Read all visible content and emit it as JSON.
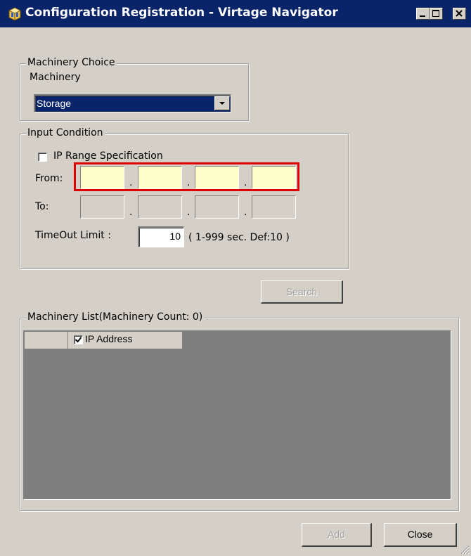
{
  "window": {
    "title": "Configuration Registration - Virtage Navigator"
  },
  "machinery_choice": {
    "group_label": "Machinery Choice",
    "field_label": "Machinery",
    "selected_value": "Storage"
  },
  "input_condition": {
    "group_label": "Input Condition",
    "ip_range_label": "IP Range Specification",
    "ip_range_checked": false,
    "from_label": "From:",
    "to_label": "To:",
    "from_octets": [
      "",
      "",
      "",
      ""
    ],
    "to_octets": [
      "",
      "",
      "",
      ""
    ],
    "octet_separator": ".",
    "timeout_label": "TimeOut Limit :",
    "timeout_value": "10",
    "timeout_hint": "( 1-999 sec. Def:10 )"
  },
  "search_button": {
    "label": "Search",
    "enabled": false
  },
  "machinery_list": {
    "group_label": "Machinery List(Machinery Count: 0)",
    "columns": [
      {
        "label": "IP Address",
        "checked": true
      }
    ],
    "rows": []
  },
  "footer": {
    "add_label": "Add",
    "add_enabled": false,
    "close_label": "Close"
  },
  "colors": {
    "titlebar": "#0a246a",
    "window_bg": "#d4d0c8",
    "highlight_border": "#e00000",
    "active_input_bg": "#ffffcc",
    "grid_bg": "#807f80"
  }
}
